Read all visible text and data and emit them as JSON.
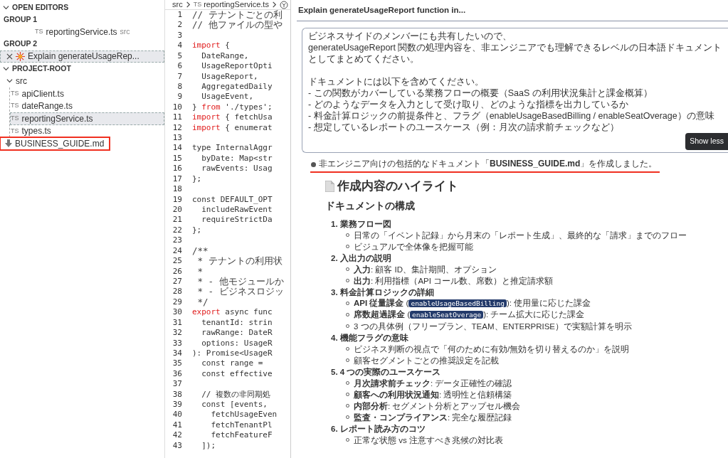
{
  "sidebar": {
    "sections": [
      {
        "title": "OPEN EDITORS",
        "expanded": true,
        "groups": [
          {
            "title": "GROUP 1",
            "items": [
              {
                "kind": "file",
                "badge": "TS",
                "label": "reportingService.ts",
                "hint": "src",
                "selected": false
              }
            ]
          },
          {
            "title": "GROUP 2",
            "items": [
              {
                "kind": "chat",
                "label": "Explain generateUsageRep...",
                "selected": true
              }
            ]
          }
        ]
      },
      {
        "title": "PROJECT-ROOT",
        "expanded": true,
        "tree": [
          {
            "kind": "folder",
            "label": "src",
            "expanded": true,
            "children": [
              {
                "kind": "file",
                "badge": "TS",
                "label": "apiClient.ts",
                "selected": false
              },
              {
                "kind": "file",
                "badge": "TS",
                "label": "dateRange.ts",
                "selected": false
              },
              {
                "kind": "file",
                "badge": "TS",
                "label": "reportingService.ts",
                "selected": true
              },
              {
                "kind": "file",
                "badge": "TS",
                "label": "types.ts",
                "selected": false
              }
            ]
          },
          {
            "kind": "download",
            "label": "BUSINESS_GUIDE.md",
            "selected": false,
            "highlighted": true
          }
        ]
      }
    ]
  },
  "editor": {
    "breadcrumb": [
      {
        "text": "src"
      },
      {
        "badge": "TS",
        "text": "reportingService.ts"
      }
    ],
    "lines": [
      {
        "number": "1",
        "parts": [
          {
            "kind": "comment",
            "text": "// テナントごとの利"
          }
        ]
      },
      {
        "number": "2",
        "parts": [
          {
            "kind": "comment",
            "text": "// 他ファイルの型や"
          }
        ]
      },
      {
        "number": "3"
      },
      {
        "number": "4",
        "parts": [
          {
            "kind": "keyword",
            "text": "import"
          },
          {
            "kind": "plain",
            "text": " {"
          }
        ]
      },
      {
        "number": "5",
        "parts": [
          {
            "kind": "plain",
            "text": "  DateRange,"
          }
        ]
      },
      {
        "number": "6",
        "parts": [
          {
            "kind": "plain",
            "text": "  UsageReportOpti"
          }
        ]
      },
      {
        "number": "7",
        "parts": [
          {
            "kind": "plain",
            "text": "  UsageReport,"
          }
        ]
      },
      {
        "number": "8",
        "parts": [
          {
            "kind": "plain",
            "text": "  AggregatedDaily"
          }
        ]
      },
      {
        "number": "9",
        "parts": [
          {
            "kind": "plain",
            "text": "  UsageEvent,"
          }
        ]
      },
      {
        "number": "10",
        "parts": [
          {
            "kind": "plain",
            "text": "} "
          },
          {
            "kind": "keyword",
            "text": "from"
          },
          {
            "kind": "plain",
            "text": " './types';"
          }
        ]
      },
      {
        "number": "11",
        "parts": [
          {
            "kind": "keyword",
            "text": "import"
          },
          {
            "kind": "plain",
            "text": " { fetchUsa"
          }
        ]
      },
      {
        "number": "12",
        "parts": [
          {
            "kind": "keyword",
            "text": "import"
          },
          {
            "kind": "plain",
            "text": " { enumerat"
          }
        ]
      },
      {
        "number": "13"
      },
      {
        "number": "14",
        "parts": [
          {
            "kind": "plain",
            "text": "type InternalAggr"
          }
        ]
      },
      {
        "number": "15",
        "parts": [
          {
            "kind": "plain",
            "text": "  byDate: Map<str"
          }
        ]
      },
      {
        "number": "16",
        "parts": [
          {
            "kind": "plain",
            "text": "  rawEvents: Usag"
          }
        ]
      },
      {
        "number": "17",
        "parts": [
          {
            "kind": "plain",
            "text": "};"
          }
        ]
      },
      {
        "number": "18"
      },
      {
        "number": "19",
        "parts": [
          {
            "kind": "plain",
            "text": "const DEFAULT_OPT"
          }
        ]
      },
      {
        "number": "20",
        "parts": [
          {
            "kind": "plain",
            "text": "  includeRawEvent"
          }
        ]
      },
      {
        "number": "21",
        "parts": [
          {
            "kind": "plain",
            "text": "  requireStrictDa"
          }
        ]
      },
      {
        "number": "22",
        "parts": [
          {
            "kind": "plain",
            "text": "};"
          }
        ]
      },
      {
        "number": "23"
      },
      {
        "number": "24",
        "parts": [
          {
            "kind": "comment",
            "text": "/**"
          }
        ]
      },
      {
        "number": "25",
        "parts": [
          {
            "kind": "comment",
            "text": " * テナントの利用状"
          }
        ]
      },
      {
        "number": "26",
        "parts": [
          {
            "kind": "comment",
            "text": " *"
          }
        ]
      },
      {
        "number": "27",
        "parts": [
          {
            "kind": "comment",
            "text": " * - 他モジュールか"
          }
        ]
      },
      {
        "number": "28",
        "parts": [
          {
            "kind": "comment",
            "text": " * - ビジネスロジッ"
          }
        ]
      },
      {
        "number": "29",
        "parts": [
          {
            "kind": "comment",
            "text": " */"
          }
        ]
      },
      {
        "number": "30",
        "parts": [
          {
            "kind": "keyword",
            "text": "export"
          },
          {
            "kind": "plain",
            "text": " async func"
          }
        ]
      },
      {
        "number": "31",
        "parts": [
          {
            "kind": "plain",
            "text": "  tenantId: strin"
          }
        ]
      },
      {
        "number": "32",
        "parts": [
          {
            "kind": "plain",
            "text": "  rawRange: DateR"
          }
        ]
      },
      {
        "number": "33",
        "parts": [
          {
            "kind": "plain",
            "text": "  options: UsageR"
          }
        ]
      },
      {
        "number": "34",
        "parts": [
          {
            "kind": "plain",
            "text": "): Promise<UsageR"
          }
        ]
      },
      {
        "number": "35",
        "parts": [
          {
            "kind": "plain",
            "text": "  const range = "
          }
        ]
      },
      {
        "number": "36",
        "parts": [
          {
            "kind": "plain",
            "text": "  const effective"
          }
        ]
      },
      {
        "number": "37"
      },
      {
        "number": "38",
        "parts": [
          {
            "kind": "plain",
            "text": "  // 複数の非同期処"
          }
        ]
      },
      {
        "number": "39",
        "parts": [
          {
            "kind": "plain",
            "text": "  const [events, "
          }
        ]
      },
      {
        "number": "40",
        "parts": [
          {
            "kind": "plain",
            "text": "    fetchUsageEven"
          }
        ]
      },
      {
        "number": "41",
        "parts": [
          {
            "kind": "plain",
            "text": "    fetchTenantPl"
          }
        ]
      },
      {
        "number": "42",
        "parts": [
          {
            "kind": "plain",
            "text": "    fetchFeatureF"
          }
        ]
      },
      {
        "number": "43",
        "parts": [
          {
            "kind": "plain",
            "text": "  ]);"
          }
        ]
      }
    ]
  },
  "chat": {
    "title": "Explain generateUsageReport function in...",
    "prompt": {
      "paragraphs": [
        [
          "ビジネスサイドのメンバーにも共有したいので、",
          "generateUsageReport 関数の処理内容を、非エンジニアでも理解できるレベルの日本語ドキュメントとしてまとめてください。"
        ],
        [
          "ドキュメントには以下を含めてください。",
          "- この関数がカバーしている業務フローの概要（SaaS の利用状況集計と課金概算）",
          "- どのようなデータを入力として受け取り、どのような指標を出力しているか",
          "- 料金計算ロジックの前提条件と、フラグ（enableUsageBasedBilling / enableSeatOverage）の意味",
          "- 想定しているレポートのユースケース（例：月次の請求前チェックなど）"
        ]
      ],
      "button": "Show less"
    },
    "response": {
      "text": "非エンジニア向けの包括的なドキュメント「**BUSINESS_GUIDE.md**」を作成しました。",
      "underlined": true
    },
    "heading": "作成内容のハイライト",
    "subheading": "ドキュメントの構成",
    "sections": [
      {
        "number": "1.",
        "title": "業務フロー図",
        "items": [
          [
            {
              "kind": "rich",
              "text": "日常の「イベント記録」から月末の「レポート生成」、最終的な「請求」までのフロー"
            }
          ],
          [
            {
              "kind": "rich",
              "text": "ビジュアルで全体像を把握可能"
            }
          ]
        ]
      },
      {
        "number": "2.",
        "title": "入出力の説明",
        "items": [
          [
            {
              "kind": "rich",
              "text": "**入力**: 顧客 ID、集計期間、オプション"
            }
          ],
          [
            {
              "kind": "rich",
              "text": "**出力**: 利用指標（API コール数、席数）と推定請求額"
            }
          ]
        ]
      },
      {
        "number": "3.",
        "title": "料金計算ロジックの詳細",
        "items": [
          [
            {
              "kind": "rich",
              "text": "**API 従量課金** ("
            },
            {
              "kind": "code",
              "text": "enableUsageBasedBilling"
            },
            {
              "kind": "rich",
              "text": "): 使用量に応じた課金"
            }
          ],
          [
            {
              "kind": "rich",
              "text": "**席数超過課金** ("
            },
            {
              "kind": "code",
              "text": "enableSeatOverage"
            },
            {
              "kind": "rich",
              "text": "): チーム拡大に応じた課金"
            }
          ],
          [
            {
              "kind": "rich",
              "text": "3 つの具体例（フリープラン、TEAM、ENTERPRISE）で実額計算を明示"
            }
          ]
        ]
      },
      {
        "number": "4.",
        "title": "機能フラグの意味",
        "items": [
          [
            {
              "kind": "rich",
              "text": "ビジネス判断の視点で「何のために有効/無効を切り替えるのか」を説明"
            }
          ],
          [
            {
              "kind": "rich",
              "text": "顧客セグメントごとの推奨設定を記載"
            }
          ]
        ]
      },
      {
        "number": "5.",
        "title": "4 つの実際のユースケース",
        "items": [
          [
            {
              "kind": "rich",
              "text": "**月次請求前チェック**: データ正確性の確認"
            }
          ],
          [
            {
              "kind": "rich",
              "text": "**顧客への利用状況通知**: 透明性と信頼構築"
            }
          ],
          [
            {
              "kind": "rich",
              "text": "**内部分析**: セグメント分析とアップセル機会"
            }
          ],
          [
            {
              "kind": "rich",
              "text": "**監査・コンプライアンス**: 完全な履歴記録"
            }
          ]
        ]
      },
      {
        "number": "6.",
        "title": "レポート読み方のコツ",
        "items": [
          [
            {
              "kind": "rich",
              "text": "正常な状態 vs 注意すべき兆候の対比表"
            }
          ]
        ]
      }
    ]
  }
}
